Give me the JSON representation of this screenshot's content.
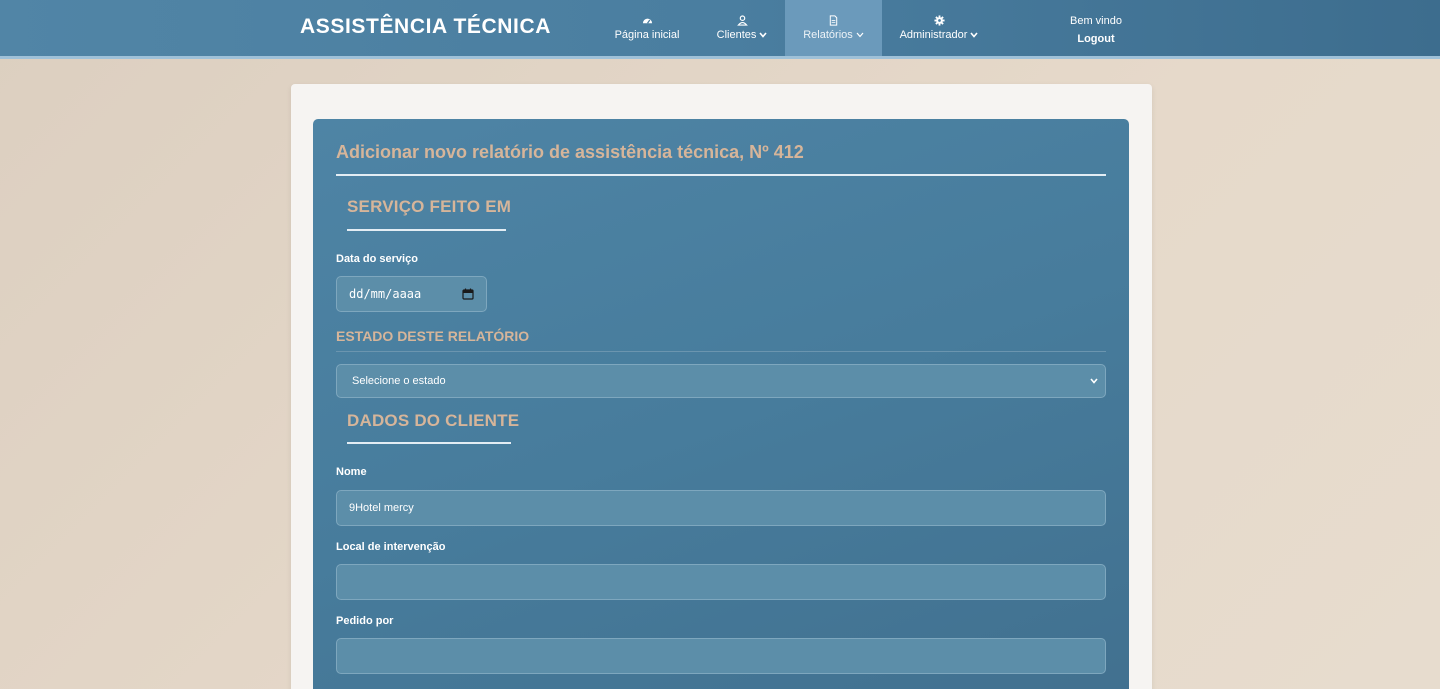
{
  "navbar": {
    "brand": "ASSISTÊNCIA TÉCNICA",
    "items": [
      {
        "label": "Página inicial",
        "icon": "dashboard-icon",
        "has_dropdown": false
      },
      {
        "label": "Clientes",
        "icon": "user-icon",
        "has_dropdown": true
      },
      {
        "label": "Relatórios",
        "icon": "document-icon",
        "has_dropdown": true,
        "active": true
      },
      {
        "label": "Administrador",
        "icon": "gear-icon",
        "has_dropdown": true
      }
    ],
    "welcome": "Bem vindo",
    "logout": "Logout"
  },
  "form": {
    "title": "Adicionar novo relatório de assistência técnica, Nº 412",
    "section_service": "SERVIÇO FEITO EM",
    "service_date_label": "Data do serviço",
    "service_date_placeholder": "dd/mm/aaaa",
    "section_status": "ESTADO DESTE RELATÓRIO",
    "status_select_value": "Selecione o estado",
    "section_client": "DADOS DO CLIENTE",
    "name_label": "Nome",
    "name_value": "9Hotel mercy",
    "location_label": "Local de intervenção",
    "location_value": "",
    "requested_by_label": "Pedido por",
    "requested_by_value": ""
  },
  "colors": {
    "navbar": "#4a7ea0",
    "panel": "#477c9c",
    "accent_text": "#d6b59a",
    "input_bg": "#5c8ea9",
    "page_bg": "#e2d6c8"
  }
}
